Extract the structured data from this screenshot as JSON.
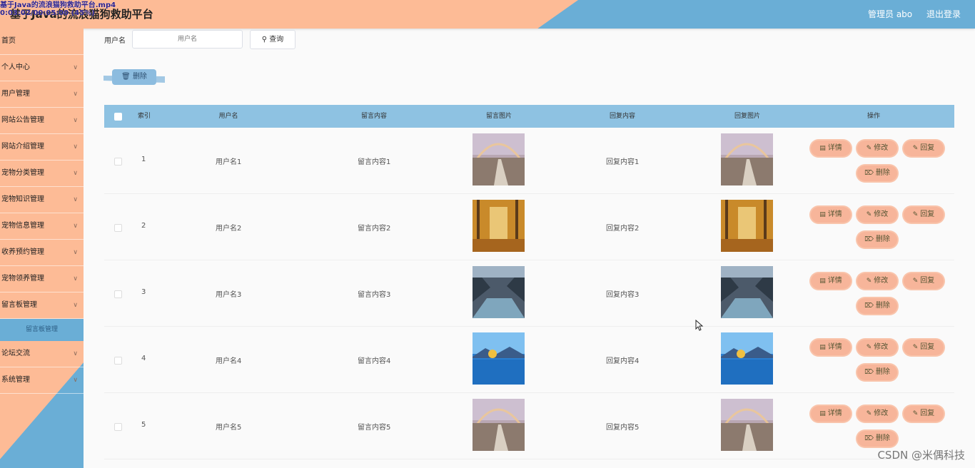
{
  "header": {
    "title": "基于Java的流浪猫狗救助平台",
    "overlay_line1": "基于Java的流浪猫狗救助平台.mp4",
    "overlay_line2": "0:03:02/00:05:00 (45%)",
    "admin_label": "管理员 abo",
    "logout_label": "退出登录"
  },
  "sidebar": {
    "items": [
      {
        "label": "首页",
        "chevron": false
      },
      {
        "label": "个人中心",
        "chevron": true
      },
      {
        "label": "用户管理",
        "chevron": true
      },
      {
        "label": "网站公告管理",
        "chevron": true
      },
      {
        "label": "网站介绍管理",
        "chevron": true
      },
      {
        "label": "宠物分类管理",
        "chevron": true
      },
      {
        "label": "宠物知识管理",
        "chevron": true
      },
      {
        "label": "宠物信息管理",
        "chevron": true
      },
      {
        "label": "收养预约管理",
        "chevron": true
      },
      {
        "label": "宠物领养管理",
        "chevron": true
      },
      {
        "label": "留言板管理",
        "chevron": true
      }
    ],
    "active_sub": "留言板管理",
    "items_after": [
      {
        "label": "论坛交流",
        "chevron": true
      },
      {
        "label": "系统管理",
        "chevron": true
      }
    ]
  },
  "search": {
    "label": "用户名",
    "placeholder": "用户名",
    "button_label": "查询",
    "search_icon": "search-icon"
  },
  "toolbar": {
    "delete_label": "删除",
    "delete_icon": "trash-icon"
  },
  "table": {
    "headers": [
      "索引",
      "用户名",
      "留言内容",
      "留言图片",
      "回复内容",
      "回复图片",
      "操作"
    ],
    "op_labels": {
      "detail": "详情",
      "edit": "修改",
      "reply": "回复",
      "delete": "删除"
    },
    "rows": [
      {
        "index": "1",
        "username": "用户名1",
        "content": "留言内容1",
        "reply": "回复内容1",
        "image": "rainbow-path"
      },
      {
        "index": "2",
        "username": "用户名2",
        "content": "留言内容2",
        "reply": "回复内容2",
        "image": "autumn-forest"
      },
      {
        "index": "3",
        "username": "用户名3",
        "content": "留言内容3",
        "reply": "回复内容3",
        "image": "mountain-river"
      },
      {
        "index": "4",
        "username": "用户名4",
        "content": "留言内容4",
        "reply": "回复内容4",
        "image": "lake-tree"
      },
      {
        "index": "5",
        "username": "用户名5",
        "content": "留言内容5",
        "reply": "回复内容5",
        "image": "rainbow-path"
      }
    ]
  },
  "watermark": "CSDN @米偶科技",
  "colors": {
    "peach": "#fdbb96",
    "blue": "#6aaed6",
    "header_row": "#8ec2e2",
    "op_button": "#f7b59a"
  }
}
